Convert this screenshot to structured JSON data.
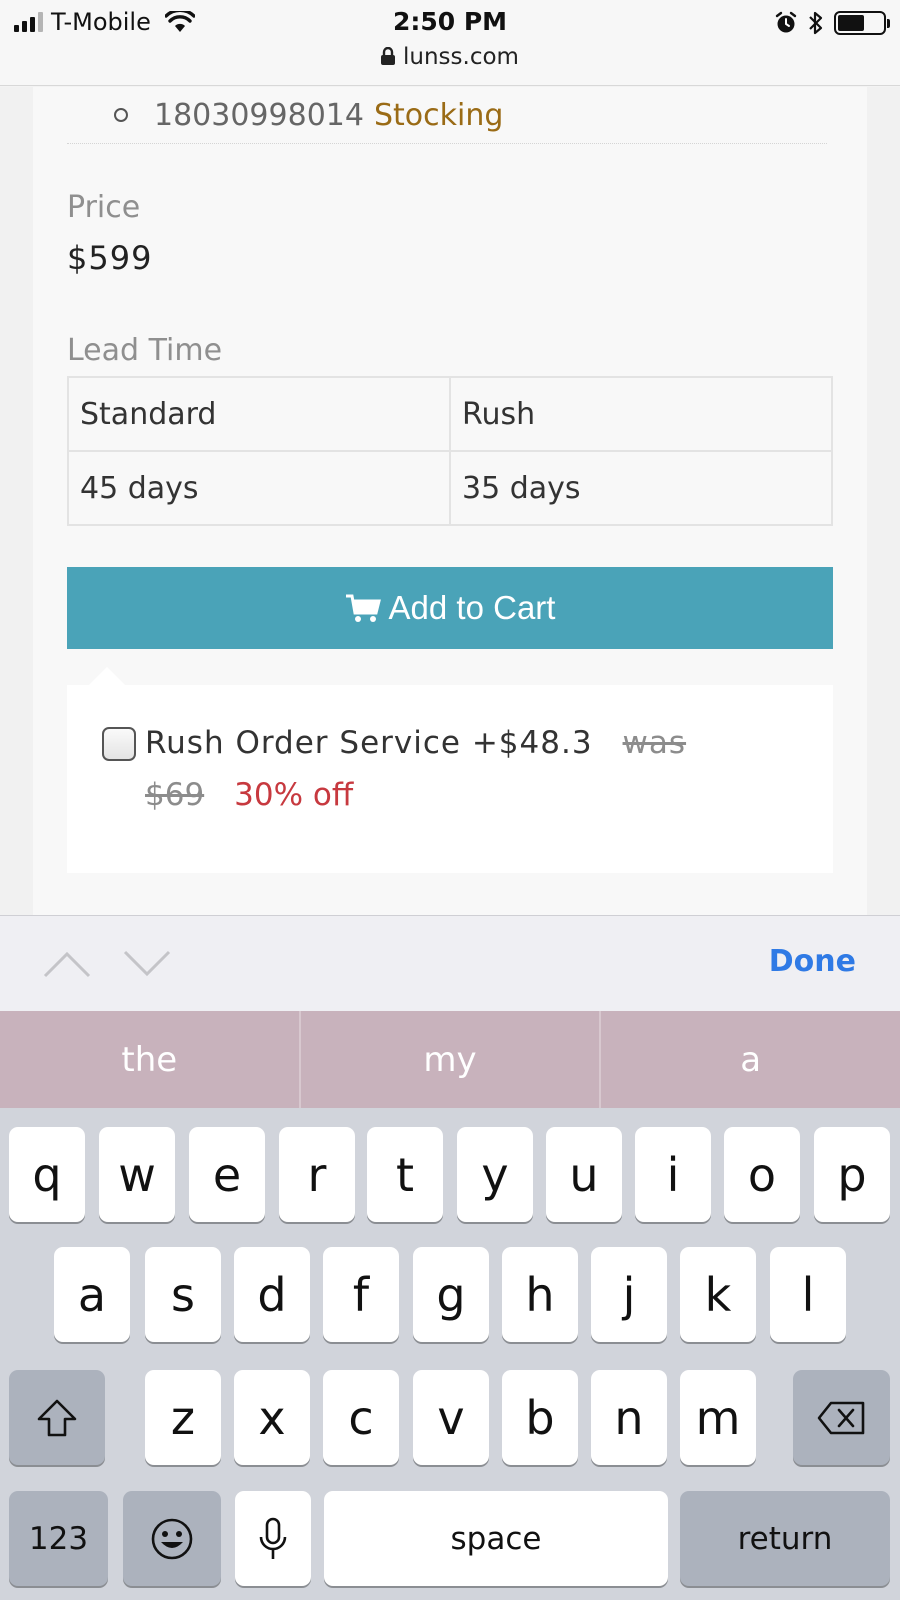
{
  "status_bar": {
    "carrier": "T-Mobile",
    "time": "2:50 PM",
    "url": "lunss.com"
  },
  "product": {
    "part_number": "18030998014",
    "stock_status": "Stocking",
    "price_label": "Price",
    "price_value": "$599",
    "lead_time_label": "Lead Time",
    "lead_table": {
      "headers": [
        "Standard",
        "Rush"
      ],
      "values": [
        "45 days",
        "35 days"
      ]
    },
    "add_to_cart_label": "Add to Cart",
    "rush": {
      "label": "Rush Order Service +$48.3",
      "was_label": "was",
      "old_price": "$69",
      "discount": "30% off",
      "checked": false
    }
  },
  "keyboard": {
    "done_label": "Done",
    "suggestions": [
      "the",
      "my",
      "a"
    ],
    "row1": [
      "q",
      "w",
      "e",
      "r",
      "t",
      "y",
      "u",
      "i",
      "o",
      "p"
    ],
    "row2": [
      "a",
      "s",
      "d",
      "f",
      "g",
      "h",
      "j",
      "k",
      "l"
    ],
    "row3": [
      "z",
      "x",
      "c",
      "v",
      "b",
      "n",
      "m"
    ],
    "numbers_label": "123",
    "space_label": "space",
    "return_label": "return",
    "icons": {
      "shift": "shift-icon",
      "delete": "delete-icon",
      "emoji": "emoji-icon",
      "mic": "microphone-icon"
    }
  },
  "colors": {
    "button": "#4aa3b8",
    "stock": "#9a6b16",
    "discount": "#c7393f",
    "done": "#2f7ae5"
  }
}
